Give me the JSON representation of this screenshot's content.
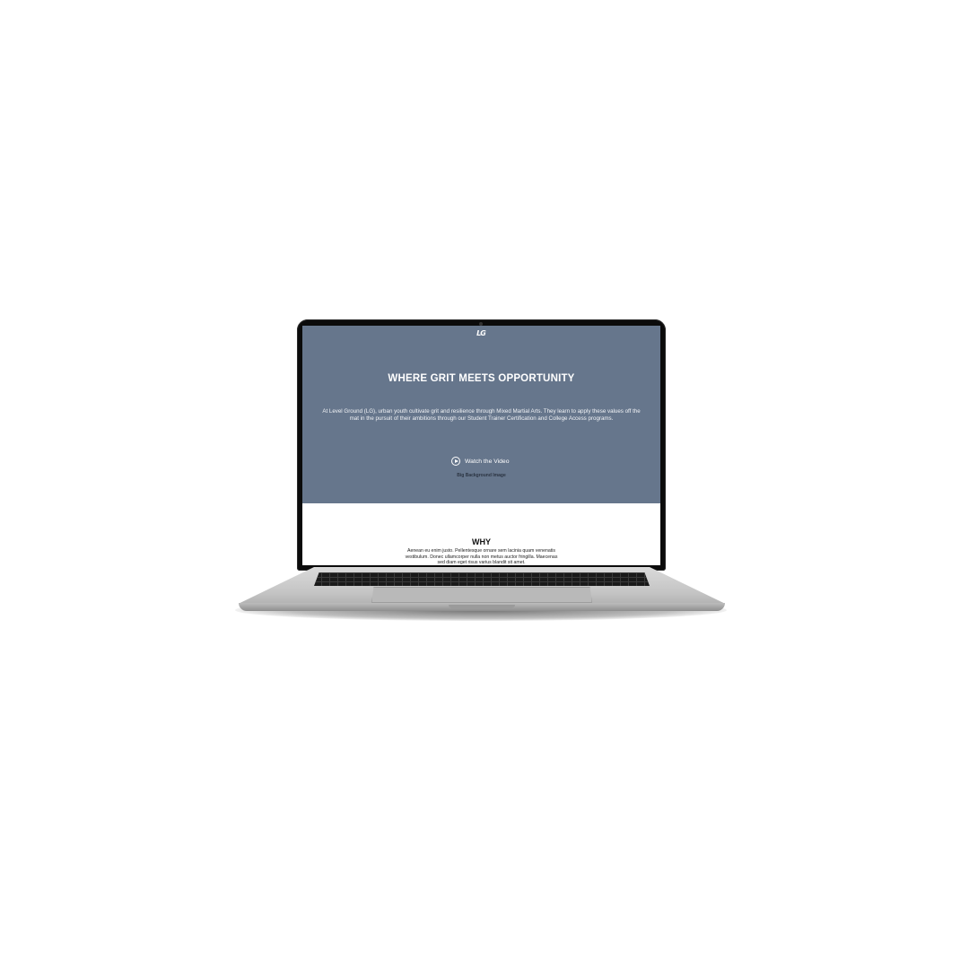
{
  "colors": {
    "hero_background": "#66768c",
    "hero_text": "#ffffff",
    "caption_text": "#2b3442",
    "section_background": "#ffffff"
  },
  "site": {
    "logo_text": "LG"
  },
  "hero": {
    "title": "WHERE GRIT MEETS OPPORTUNITY",
    "body": "At Level Ground (LG), urban youth cultivate grit and resilience through Mixed Martial Arts. They learn to apply these values off the mat in the pursuit of their ambitions through our Student Trainer Certification and College Access programs.",
    "watch_label": "Watch the Video",
    "watch_icon": "play-circle-icon",
    "background_caption": "Big Background Image"
  },
  "why": {
    "title": "WHY",
    "body": "Aenean eu enim justo. Pellentesque ornare sem lacinia quam venenatis vestibulum. Donec ullamcorper nulla non metus auctor fringilla. Maecenas sed diam eget risus varius blandit sit amet."
  }
}
